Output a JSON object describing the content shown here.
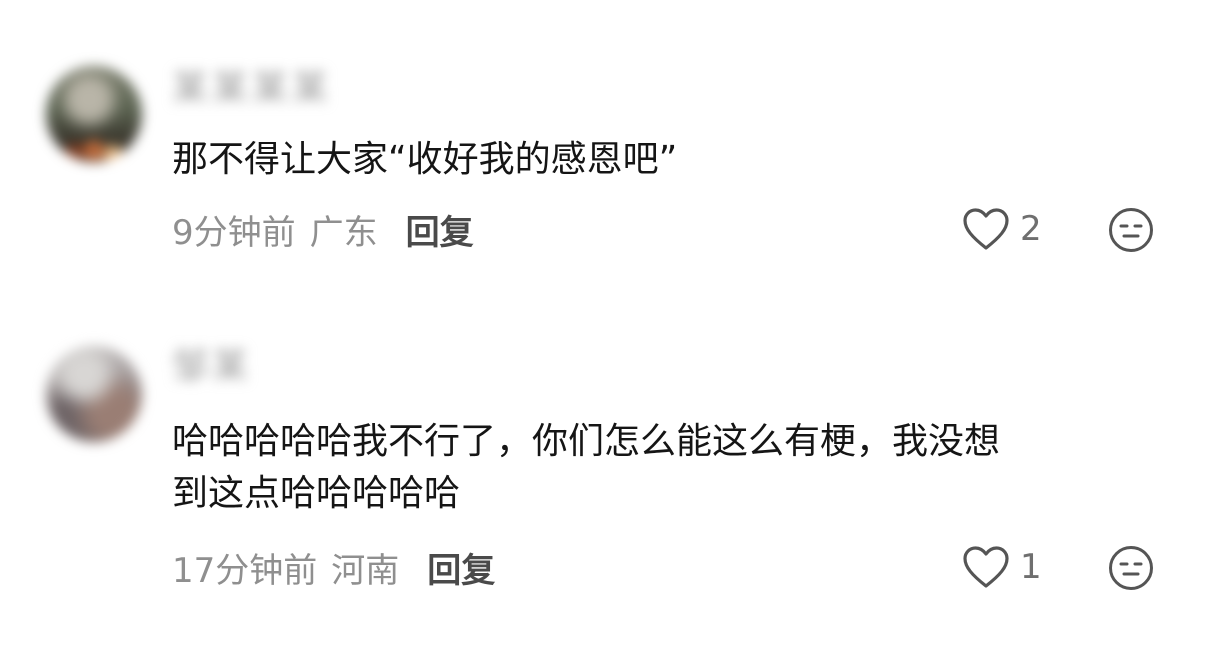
{
  "comments": [
    {
      "username": "某某某某",
      "text": "那不得让大家“收好我的感恩吧”",
      "time": "9分钟前",
      "region": "广东",
      "reply_label": "回复",
      "like_count": "2",
      "like_icon": "heart-outline-icon",
      "emoji_icon": "neutral-face-icon"
    },
    {
      "username": "邹某",
      "text_lines": [
        "哈哈哈哈哈我不行了，你们怎么能这么有梗，我没想",
        "到这点哈哈哈哈哈"
      ],
      "time": "17分钟前",
      "region": "河南",
      "reply_label": "回复",
      "like_count": "1",
      "like_icon": "heart-outline-icon",
      "emoji_icon": "neutral-face-icon"
    }
  ],
  "colors": {
    "background": "#ffffff",
    "text_primary": "#151515",
    "text_meta": "#8f8f8f",
    "text_reply": "#4a4a4a",
    "icon_stroke": "#555555"
  }
}
